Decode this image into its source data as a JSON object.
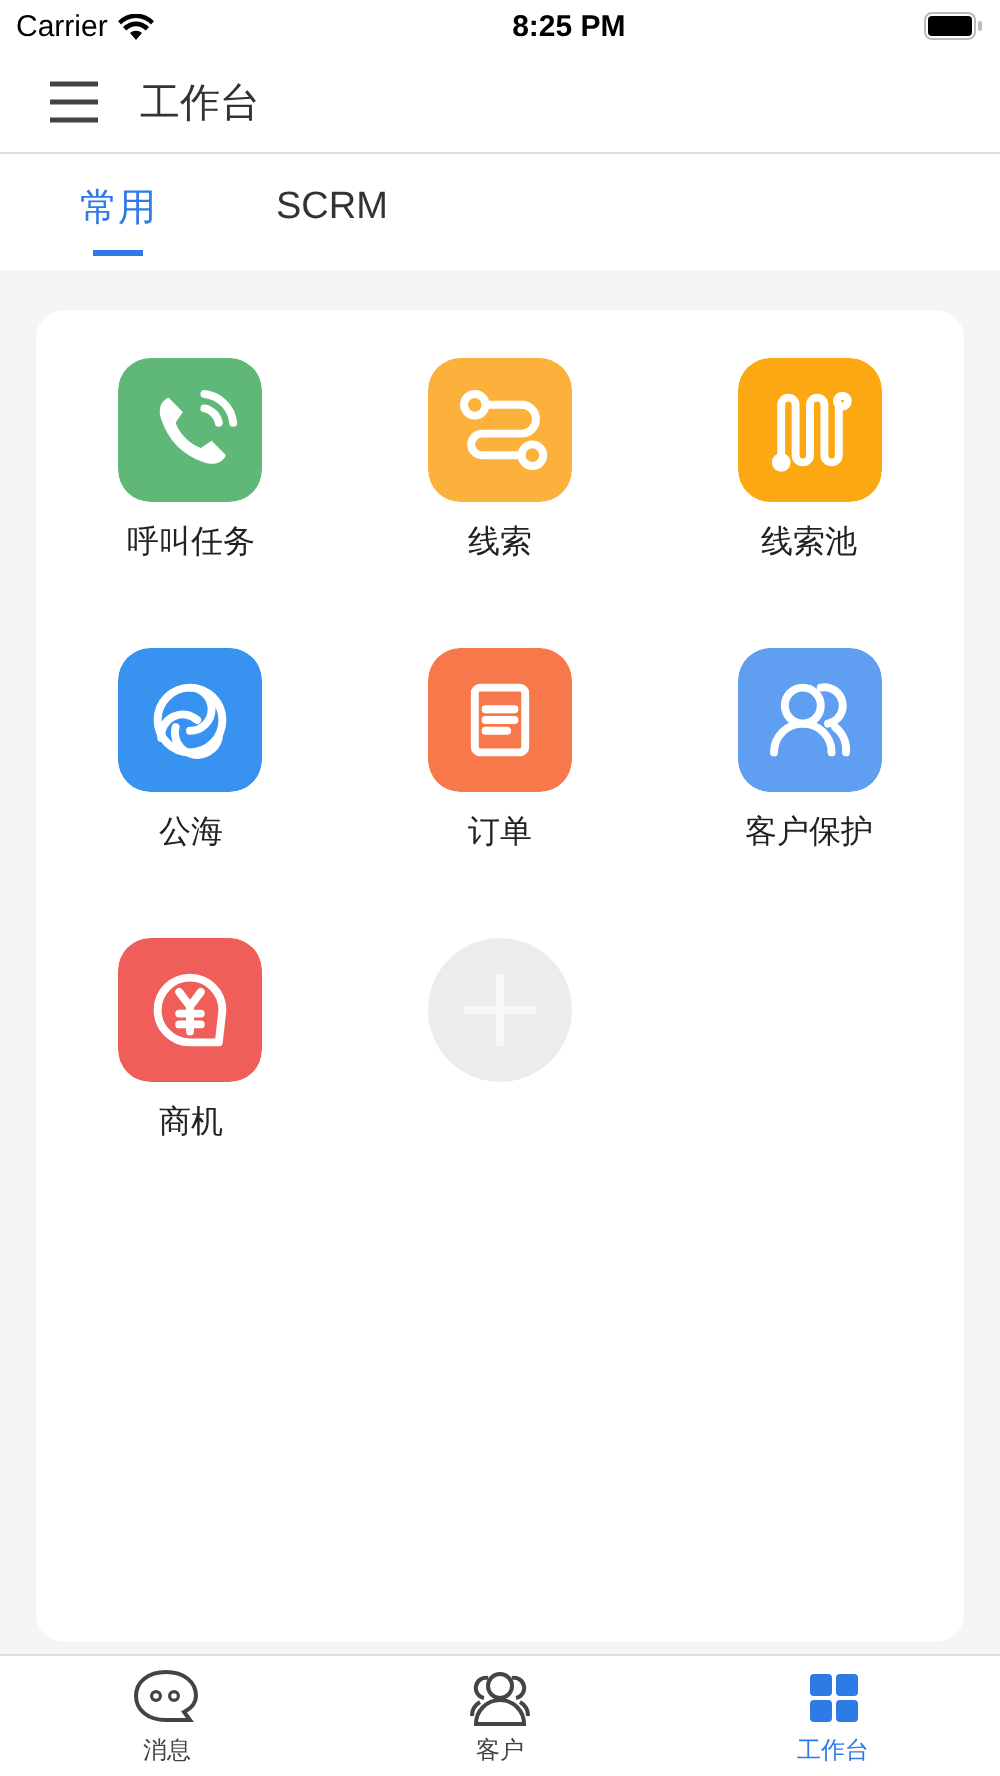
{
  "status_bar": {
    "carrier": "Carrier",
    "time": "8:25 PM"
  },
  "header": {
    "title": "工作台"
  },
  "tabs": [
    {
      "label": "常用",
      "selected": true
    },
    {
      "label": "SCRM",
      "selected": false
    }
  ],
  "apps": [
    {
      "kind": "phone",
      "label": "呼叫任务",
      "color": "#5fb878"
    },
    {
      "kind": "route",
      "label": "线索",
      "color": "#fbb13c"
    },
    {
      "kind": "pool",
      "label": "线索池",
      "color": "#fba812"
    },
    {
      "kind": "sea",
      "label": "公海",
      "color": "#3792f0"
    },
    {
      "kind": "order",
      "label": "订单",
      "color": "#f7794b"
    },
    {
      "kind": "customers",
      "label": "客户保护",
      "color": "#5f9ef0"
    },
    {
      "kind": "deal",
      "label": "商机",
      "color": "#ef5e58"
    },
    {
      "kind": "add"
    }
  ],
  "bottom_tabs": [
    {
      "kind": "chat",
      "label": "消息",
      "selected": false
    },
    {
      "kind": "people",
      "label": "客户",
      "selected": false
    },
    {
      "kind": "grid",
      "label": "工作台",
      "selected": true
    }
  ]
}
